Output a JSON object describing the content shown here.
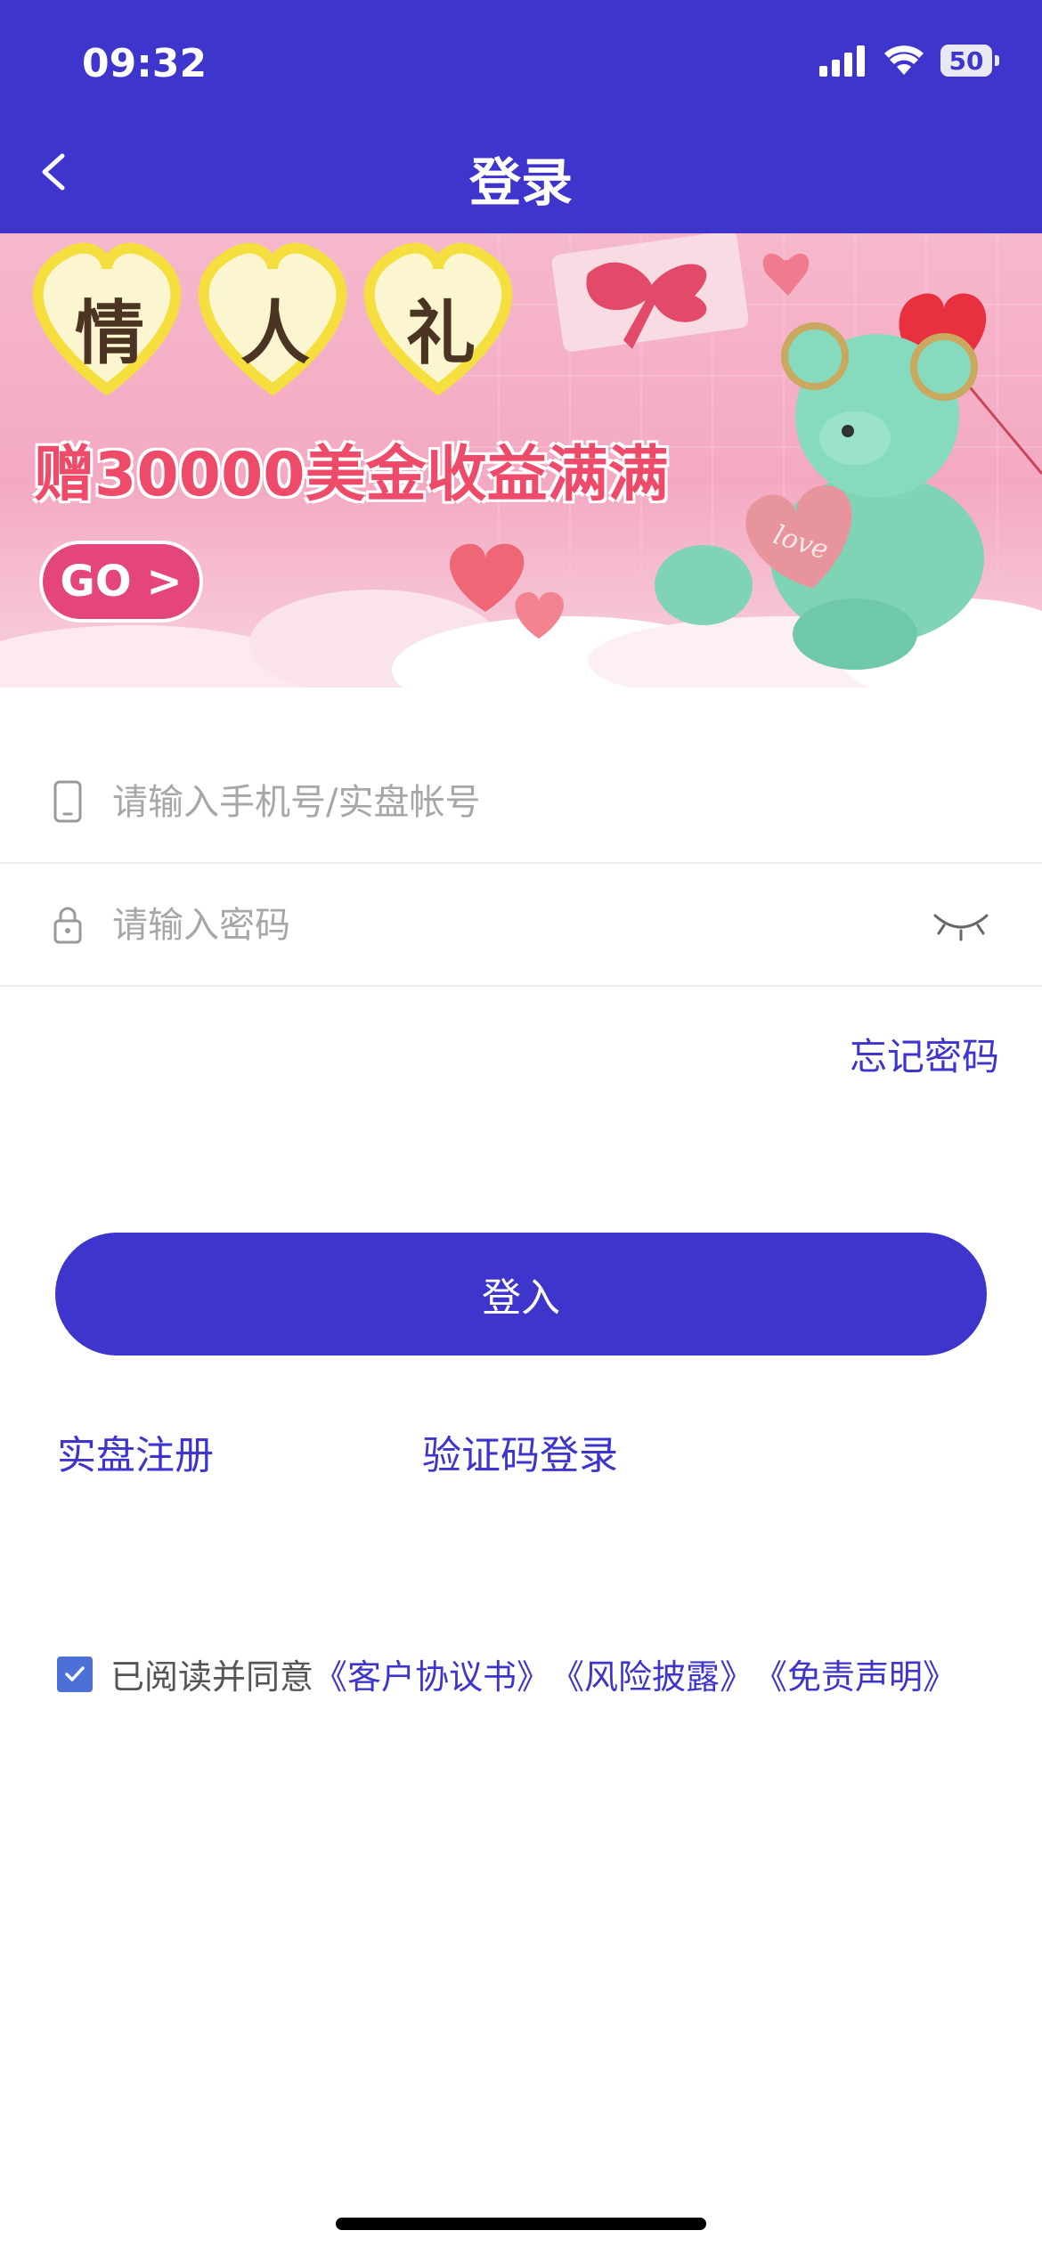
{
  "status_bar": {
    "time": "09:32",
    "battery": "50"
  },
  "header": {
    "title": "登录"
  },
  "banner": {
    "hearts": [
      "情",
      "人",
      "礼"
    ],
    "promo_text": "赠30000美金收益满满",
    "go_label": "GO >",
    "bear_heart_text": "love"
  },
  "form": {
    "phone_placeholder": "请输入手机号/实盘帐号",
    "password_placeholder": "请输入密码",
    "forgot_label": "忘记密码",
    "login_label": "登入",
    "register_label": "实盘注册",
    "code_login_label": "验证码登录"
  },
  "agreement": {
    "checked": true,
    "prefix": "已阅读并同意",
    "links": [
      "《客户协议书》",
      "《风险披露》",
      "《免责声明》"
    ]
  },
  "colors": {
    "accent": "#3d35cc",
    "checkbox": "#4d6fd8",
    "banner_pink": "#f4a9c2"
  }
}
